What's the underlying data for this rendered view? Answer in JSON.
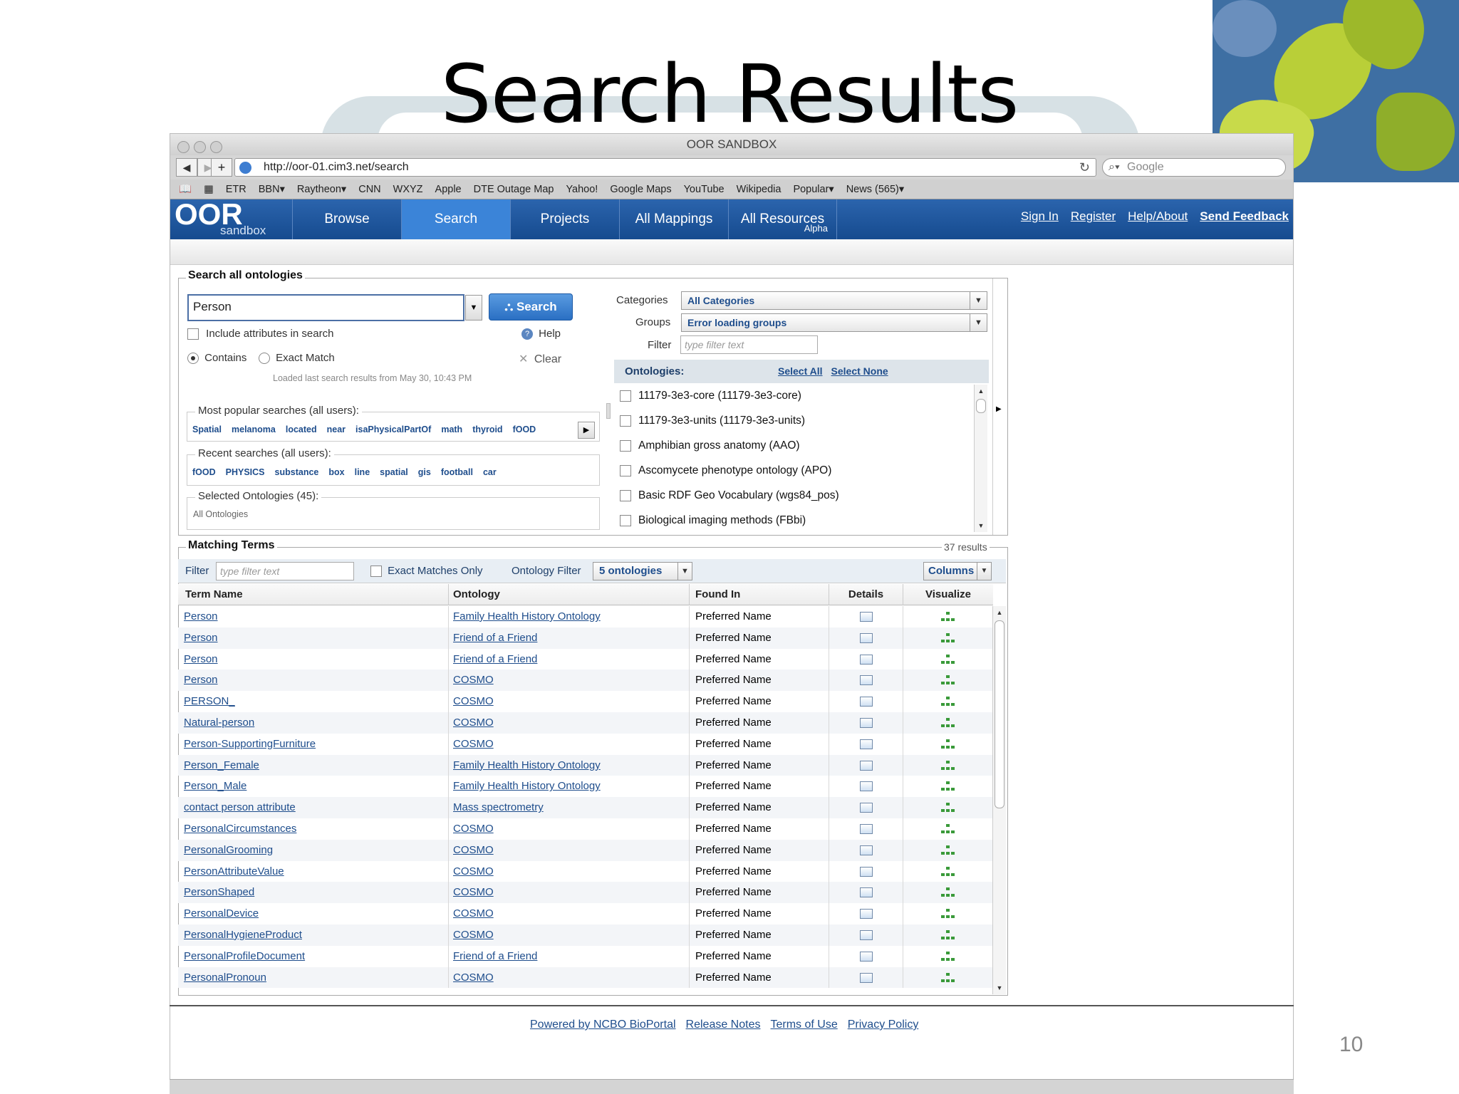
{
  "slide": {
    "title": "Search Results",
    "page_number": "10"
  },
  "browser": {
    "window_title": "OOR SANDBOX",
    "url": "http://oor-01.cim3.net/search",
    "search_placeholder": "Google",
    "bookmarks": [
      "ETR",
      "BBN▾",
      "Raytheon▾",
      "CNN",
      "WXYZ",
      "Apple",
      "DTE Outage Map",
      "Yahoo!",
      "Google Maps",
      "YouTube",
      "Wikipedia",
      "Popular▾",
      "News (565)▾"
    ]
  },
  "app": {
    "logo": "OOR",
    "logo_sub": "sandbox",
    "tabs": [
      {
        "label": "Browse"
      },
      {
        "label": "Search",
        "active": true
      },
      {
        "label": "Projects"
      },
      {
        "label": "All Mappings"
      },
      {
        "label": "All Resources",
        "badge": "Alpha"
      }
    ],
    "auth_links": [
      "Sign In",
      "Register",
      "Help/About",
      "Send Feedback"
    ]
  },
  "search_panel": {
    "legend": "Search all ontologies",
    "query": "Person",
    "search_button": "Search",
    "include_attributes_label": "Include attributes in search",
    "help_label": "Help",
    "contains_label": "Contains",
    "exact_match_label": "Exact Match",
    "clear_label": "Clear",
    "loaded_note": "Loaded last search results from May 30, 10:43 PM",
    "popular_label": "Most popular searches (all users):",
    "popular_tags": [
      "Spatial",
      "melanoma",
      "located",
      "near",
      "isaPhysicalPartOf",
      "math",
      "thyroid",
      "fOOD"
    ],
    "recent_label": "Recent searches (all users):",
    "recent_tags": [
      "fOOD",
      "PHYSICS",
      "substance",
      "box",
      "line",
      "spatial",
      "gis",
      "football",
      "car"
    ],
    "selected_label": "Selected Ontologies (45):",
    "selected_value": "All Ontologies"
  },
  "filters": {
    "categories_label": "Categories",
    "categories_value": "All Categories",
    "groups_label": "Groups",
    "groups_value": "Error loading groups",
    "filter_label": "Filter",
    "filter_placeholder": "type filter text",
    "ontologies_label": "Ontologies:",
    "select_all": "Select All",
    "select_none": "Select None",
    "ontologies": [
      "11179-3e3-core (11179-3e3-core)",
      "11179-3e3-units (11179-3e3-units)",
      "Amphibian gross anatomy (AAO)",
      "Ascomycete phenotype ontology (APO)",
      "Basic RDF Geo Vocabulary (wgs84_pos)",
      "Biological imaging methods (FBbi)"
    ]
  },
  "matching": {
    "legend": "Matching Terms",
    "results_count": "37 results",
    "filter_label": "Filter",
    "filter_placeholder": "type filter text",
    "exact_only_label": "Exact Matches Only",
    "ontology_filter_label": "Ontology Filter",
    "ontology_filter_value": "5 ontologies",
    "columns_button": "Columns",
    "headers": [
      "Term Name",
      "Ontology",
      "Found In",
      "Details",
      "Visualize"
    ],
    "rows": [
      {
        "term": "Person",
        "ontology": "Family Health History Ontology",
        "found": "Preferred Name"
      },
      {
        "term": "Person",
        "ontology": "Friend of a Friend",
        "found": "Preferred Name"
      },
      {
        "term": "Person",
        "ontology": "Friend of a Friend",
        "found": "Preferred Name"
      },
      {
        "term": "Person",
        "ontology": "COSMO",
        "found": "Preferred Name"
      },
      {
        "term": "PERSON_",
        "ontology": "COSMO",
        "found": "Preferred Name"
      },
      {
        "term": "Natural-person",
        "ontology": "COSMO",
        "found": "Preferred Name"
      },
      {
        "term": "Person-SupportingFurniture",
        "ontology": "COSMO",
        "found": "Preferred Name"
      },
      {
        "term": "Person_Female",
        "ontology": "Family Health History Ontology",
        "found": "Preferred Name"
      },
      {
        "term": "Person_Male",
        "ontology": "Family Health History Ontology",
        "found": "Preferred Name"
      },
      {
        "term": "contact person attribute",
        "ontology": "Mass spectrometry",
        "found": "Preferred Name"
      },
      {
        "term": "PersonalCircumstances",
        "ontology": "COSMO",
        "found": "Preferred Name"
      },
      {
        "term": "PersonalGrooming",
        "ontology": "COSMO",
        "found": "Preferred Name"
      },
      {
        "term": "PersonAttributeValue",
        "ontology": "COSMO",
        "found": "Preferred Name"
      },
      {
        "term": "PersonShaped",
        "ontology": "COSMO",
        "found": "Preferred Name"
      },
      {
        "term": "PersonalDevice",
        "ontology": "COSMO",
        "found": "Preferred Name"
      },
      {
        "term": "PersonalHygieneProduct",
        "ontology": "COSMO",
        "found": "Preferred Name"
      },
      {
        "term": "PersonalProfileDocument",
        "ontology": "Friend of a Friend",
        "found": "Preferred Name"
      },
      {
        "term": "PersonalPronoun",
        "ontology": "COSMO",
        "found": "Preferred Name"
      }
    ]
  },
  "footer": {
    "links": [
      "Powered by NCBO BioPortal",
      "Release Notes",
      "Terms of Use",
      "Privacy Policy"
    ]
  },
  "colors": {
    "nav_bar": "#164b8f",
    "active_tab": "#3b84d8",
    "link": "#1e4d8c"
  }
}
